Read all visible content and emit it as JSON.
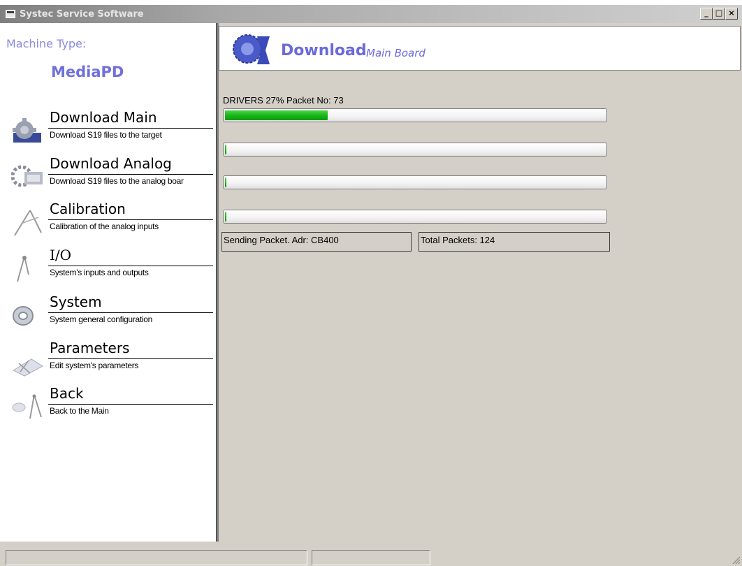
{
  "window": {
    "title": "Systec Service Software",
    "buttons": {
      "minimize": "_",
      "maximize": "□",
      "close": "×"
    }
  },
  "sidebar": {
    "machine_type_label": "Machine Type:",
    "machine_type_value": "MediaPD",
    "items": [
      {
        "title": "Download Main",
        "description": "Download S19 files to the target",
        "icon": "gear-chip-icon"
      },
      {
        "title": "Download Analog",
        "description": "Download S19 files to the analog boar",
        "icon": "gear-analog-icon"
      },
      {
        "title": "Calibration",
        "description": "Calibration of the analog inputs",
        "icon": "compass-icon"
      },
      {
        "title": "I/O",
        "description": "System's inputs and outputs",
        "icon": "compass-small-icon"
      },
      {
        "title": "System",
        "description": "System general configuration",
        "icon": "disc-icon"
      },
      {
        "title": "Parameters",
        "description": "Edit system's parameters",
        "icon": "drafting-icon"
      },
      {
        "title": "Back",
        "description": "Back to the Main",
        "icon": "back-compass-icon"
      }
    ]
  },
  "header": {
    "title": "Download",
    "subtitle": "Main Board",
    "icon": "gear-download-icon"
  },
  "progress": {
    "label": "DRIVERS 27%  Packet No: 73",
    "bars": [
      0.27,
      0.0,
      0.0,
      0.0
    ]
  },
  "status": {
    "sending": "Sending Packet. Adr: CB400",
    "total": "Total Packets: 124"
  },
  "colors": {
    "accent": "#6a6adc",
    "progress_fill": "#18b818",
    "panel_bg": "#d4d0c8"
  }
}
